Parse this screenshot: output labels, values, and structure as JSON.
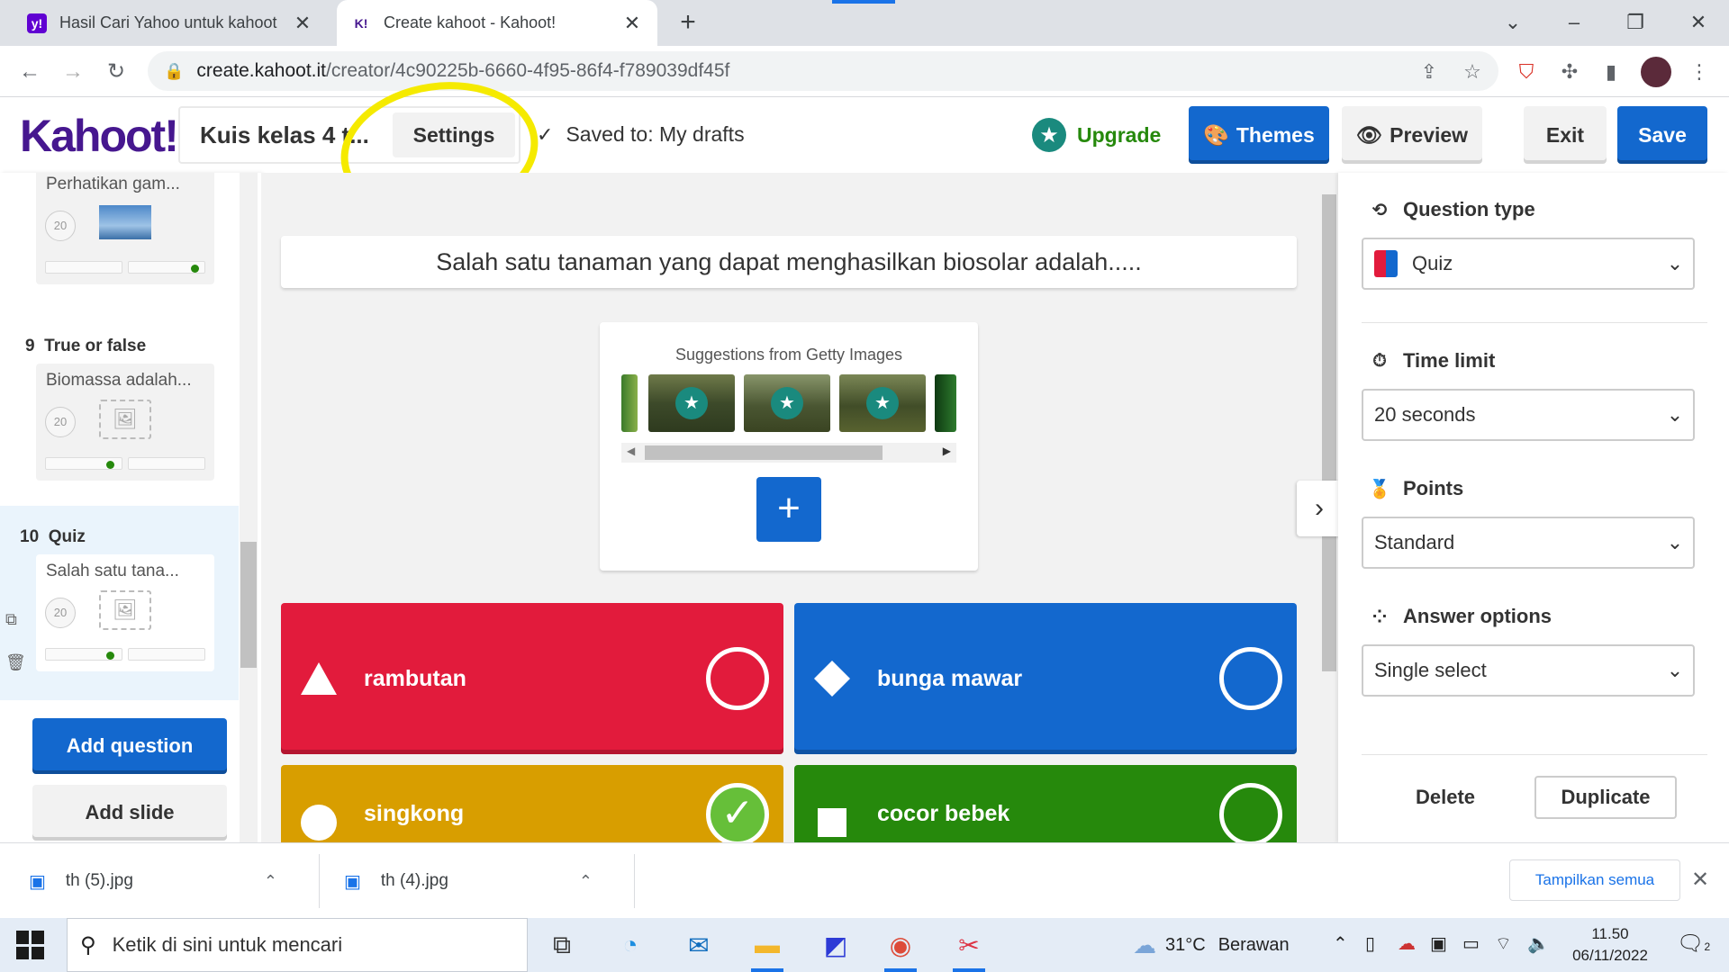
{
  "browser": {
    "tabs": [
      {
        "title": "Hasil Cari Yahoo untuk kahoot",
        "favicon": "y!",
        "favicon_color": "#6001d2"
      },
      {
        "title": "Create kahoot - Kahoot!",
        "favicon": "K!",
        "favicon_color": "#46178f"
      }
    ],
    "url_host": "create.kahoot.it",
    "url_path": "/creator/4c90225b-6660-4f95-86f4-f789039df45f"
  },
  "header": {
    "logo": "Kahoot!",
    "kahoot_title": "Kuis kelas 4 t...",
    "settings_label": "Settings",
    "saved_status": "Saved to: My drafts",
    "upgrade_label": "Upgrade",
    "themes_label": "Themes",
    "preview_label": "Preview",
    "exit_label": "Exit",
    "save_label": "Save"
  },
  "sidebar": {
    "questions": [
      {
        "number": "",
        "type": "",
        "title": "Perhatikan gam...",
        "time": "20",
        "has_image": true
      },
      {
        "number": "9",
        "type": "True or false",
        "title": "Biomassa adalah...",
        "time": "20",
        "has_image": false
      },
      {
        "number": "10",
        "type": "Quiz",
        "title": "Salah satu tana...",
        "time": "20",
        "has_image": false,
        "active": true
      }
    ],
    "add_question_label": "Add question",
    "add_slide_label": "Add slide"
  },
  "editor": {
    "question_text": "Salah satu tanaman yang dapat menghasilkan biosolar adalah.....",
    "media_caption": "Suggestions from Getty Images",
    "answers": [
      {
        "text": "rambutan",
        "color": "#e21b3c",
        "shape": "triangle",
        "correct": false
      },
      {
        "text": "bunga mawar",
        "color": "#1368ce",
        "shape": "diamond",
        "correct": false
      },
      {
        "text": "singkong",
        "color": "#d89e00",
        "shape": "circle",
        "correct": true
      },
      {
        "text": "cocor bebek",
        "color": "#26890c",
        "shape": "square",
        "correct": false
      }
    ]
  },
  "settings_panel": {
    "question_type_label": "Question type",
    "question_type_value": "Quiz",
    "time_limit_label": "Time limit",
    "time_limit_value": "20 seconds",
    "points_label": "Points",
    "points_value": "Standard",
    "answer_options_label": "Answer options",
    "answer_options_value": "Single select",
    "delete_label": "Delete",
    "duplicate_label": "Duplicate"
  },
  "downloads": {
    "items": [
      {
        "name": "th (5).jpg"
      },
      {
        "name": "th (4).jpg"
      }
    ],
    "show_all_label": "Tampilkan semua"
  },
  "taskbar": {
    "search_placeholder": "Ketik di sini untuk mencari",
    "weather_temp": "31°C",
    "weather_desc": "Berawan",
    "time": "11.50",
    "date": "06/11/2022",
    "notification_count": "2"
  }
}
